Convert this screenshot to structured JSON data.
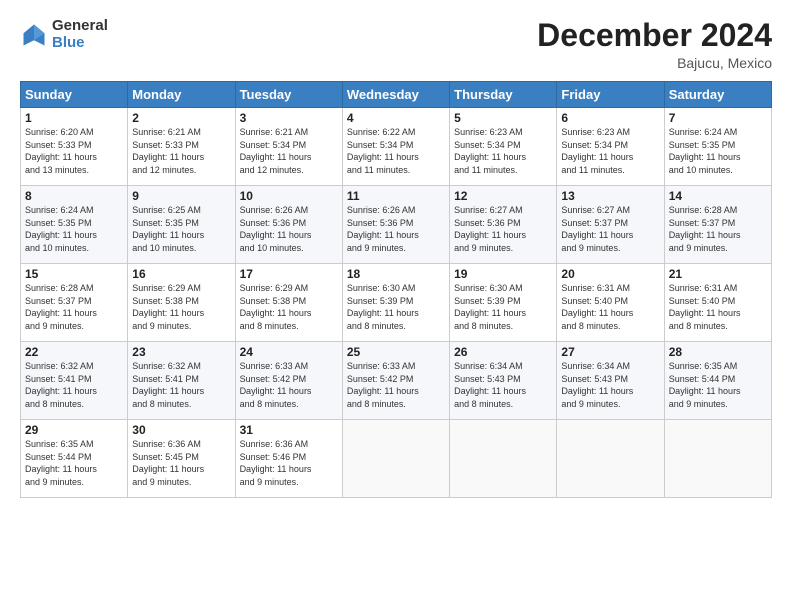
{
  "header": {
    "logo_general": "General",
    "logo_blue": "Blue",
    "title": "December 2024",
    "location": "Bajucu, Mexico"
  },
  "days_of_week": [
    "Sunday",
    "Monday",
    "Tuesday",
    "Wednesday",
    "Thursday",
    "Friday",
    "Saturday"
  ],
  "weeks": [
    [
      {
        "day": "1",
        "info": "Sunrise: 6:20 AM\nSunset: 5:33 PM\nDaylight: 11 hours\nand 13 minutes."
      },
      {
        "day": "2",
        "info": "Sunrise: 6:21 AM\nSunset: 5:33 PM\nDaylight: 11 hours\nand 12 minutes."
      },
      {
        "day": "3",
        "info": "Sunrise: 6:21 AM\nSunset: 5:34 PM\nDaylight: 11 hours\nand 12 minutes."
      },
      {
        "day": "4",
        "info": "Sunrise: 6:22 AM\nSunset: 5:34 PM\nDaylight: 11 hours\nand 11 minutes."
      },
      {
        "day": "5",
        "info": "Sunrise: 6:23 AM\nSunset: 5:34 PM\nDaylight: 11 hours\nand 11 minutes."
      },
      {
        "day": "6",
        "info": "Sunrise: 6:23 AM\nSunset: 5:34 PM\nDaylight: 11 hours\nand 11 minutes."
      },
      {
        "day": "7",
        "info": "Sunrise: 6:24 AM\nSunset: 5:35 PM\nDaylight: 11 hours\nand 10 minutes."
      }
    ],
    [
      {
        "day": "8",
        "info": "Sunrise: 6:24 AM\nSunset: 5:35 PM\nDaylight: 11 hours\nand 10 minutes."
      },
      {
        "day": "9",
        "info": "Sunrise: 6:25 AM\nSunset: 5:35 PM\nDaylight: 11 hours\nand 10 minutes."
      },
      {
        "day": "10",
        "info": "Sunrise: 6:26 AM\nSunset: 5:36 PM\nDaylight: 11 hours\nand 10 minutes."
      },
      {
        "day": "11",
        "info": "Sunrise: 6:26 AM\nSunset: 5:36 PM\nDaylight: 11 hours\nand 9 minutes."
      },
      {
        "day": "12",
        "info": "Sunrise: 6:27 AM\nSunset: 5:36 PM\nDaylight: 11 hours\nand 9 minutes."
      },
      {
        "day": "13",
        "info": "Sunrise: 6:27 AM\nSunset: 5:37 PM\nDaylight: 11 hours\nand 9 minutes."
      },
      {
        "day": "14",
        "info": "Sunrise: 6:28 AM\nSunset: 5:37 PM\nDaylight: 11 hours\nand 9 minutes."
      }
    ],
    [
      {
        "day": "15",
        "info": "Sunrise: 6:28 AM\nSunset: 5:37 PM\nDaylight: 11 hours\nand 9 minutes."
      },
      {
        "day": "16",
        "info": "Sunrise: 6:29 AM\nSunset: 5:38 PM\nDaylight: 11 hours\nand 9 minutes."
      },
      {
        "day": "17",
        "info": "Sunrise: 6:29 AM\nSunset: 5:38 PM\nDaylight: 11 hours\nand 8 minutes."
      },
      {
        "day": "18",
        "info": "Sunrise: 6:30 AM\nSunset: 5:39 PM\nDaylight: 11 hours\nand 8 minutes."
      },
      {
        "day": "19",
        "info": "Sunrise: 6:30 AM\nSunset: 5:39 PM\nDaylight: 11 hours\nand 8 minutes."
      },
      {
        "day": "20",
        "info": "Sunrise: 6:31 AM\nSunset: 5:40 PM\nDaylight: 11 hours\nand 8 minutes."
      },
      {
        "day": "21",
        "info": "Sunrise: 6:31 AM\nSunset: 5:40 PM\nDaylight: 11 hours\nand 8 minutes."
      }
    ],
    [
      {
        "day": "22",
        "info": "Sunrise: 6:32 AM\nSunset: 5:41 PM\nDaylight: 11 hours\nand 8 minutes."
      },
      {
        "day": "23",
        "info": "Sunrise: 6:32 AM\nSunset: 5:41 PM\nDaylight: 11 hours\nand 8 minutes."
      },
      {
        "day": "24",
        "info": "Sunrise: 6:33 AM\nSunset: 5:42 PM\nDaylight: 11 hours\nand 8 minutes."
      },
      {
        "day": "25",
        "info": "Sunrise: 6:33 AM\nSunset: 5:42 PM\nDaylight: 11 hours\nand 8 minutes."
      },
      {
        "day": "26",
        "info": "Sunrise: 6:34 AM\nSunset: 5:43 PM\nDaylight: 11 hours\nand 8 minutes."
      },
      {
        "day": "27",
        "info": "Sunrise: 6:34 AM\nSunset: 5:43 PM\nDaylight: 11 hours\nand 9 minutes."
      },
      {
        "day": "28",
        "info": "Sunrise: 6:35 AM\nSunset: 5:44 PM\nDaylight: 11 hours\nand 9 minutes."
      }
    ],
    [
      {
        "day": "29",
        "info": "Sunrise: 6:35 AM\nSunset: 5:44 PM\nDaylight: 11 hours\nand 9 minutes."
      },
      {
        "day": "30",
        "info": "Sunrise: 6:36 AM\nSunset: 5:45 PM\nDaylight: 11 hours\nand 9 minutes."
      },
      {
        "day": "31",
        "info": "Sunrise: 6:36 AM\nSunset: 5:46 PM\nDaylight: 11 hours\nand 9 minutes."
      },
      null,
      null,
      null,
      null
    ]
  ]
}
